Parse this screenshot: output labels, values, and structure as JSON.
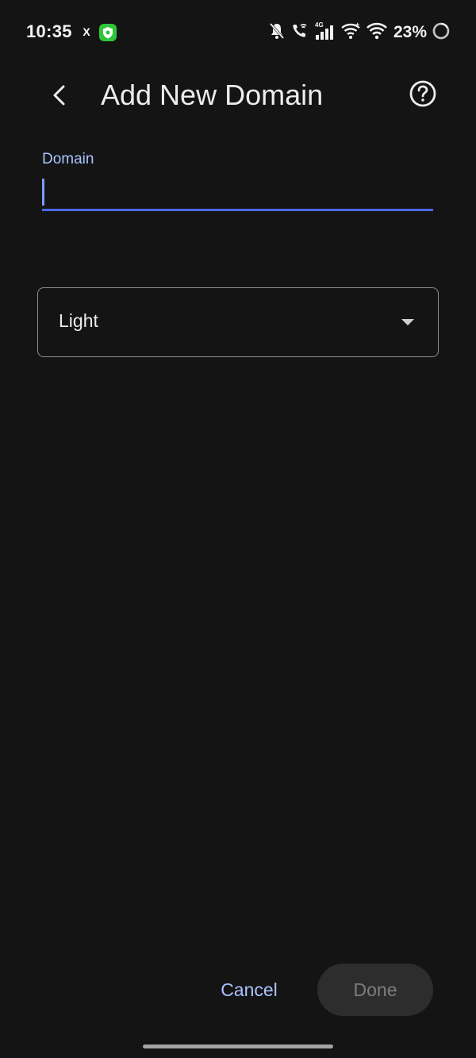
{
  "status_bar": {
    "time": "10:35",
    "notification_x": "X",
    "signal_label": "4G",
    "battery_percent": "23%"
  },
  "header": {
    "title": "Add New Domain",
    "back_icon": "chevron-left-icon",
    "help_icon": "help-circle-icon"
  },
  "form": {
    "domain_label": "Domain",
    "domain_value": "",
    "theme_select": {
      "selected": "Light"
    }
  },
  "actions": {
    "cancel_label": "Cancel",
    "done_label": "Done"
  },
  "colors": {
    "background": "#141414",
    "accent": "#4a66e8",
    "label_accent": "#a9c3ff",
    "disabled_button_bg": "#2d2d2d"
  }
}
